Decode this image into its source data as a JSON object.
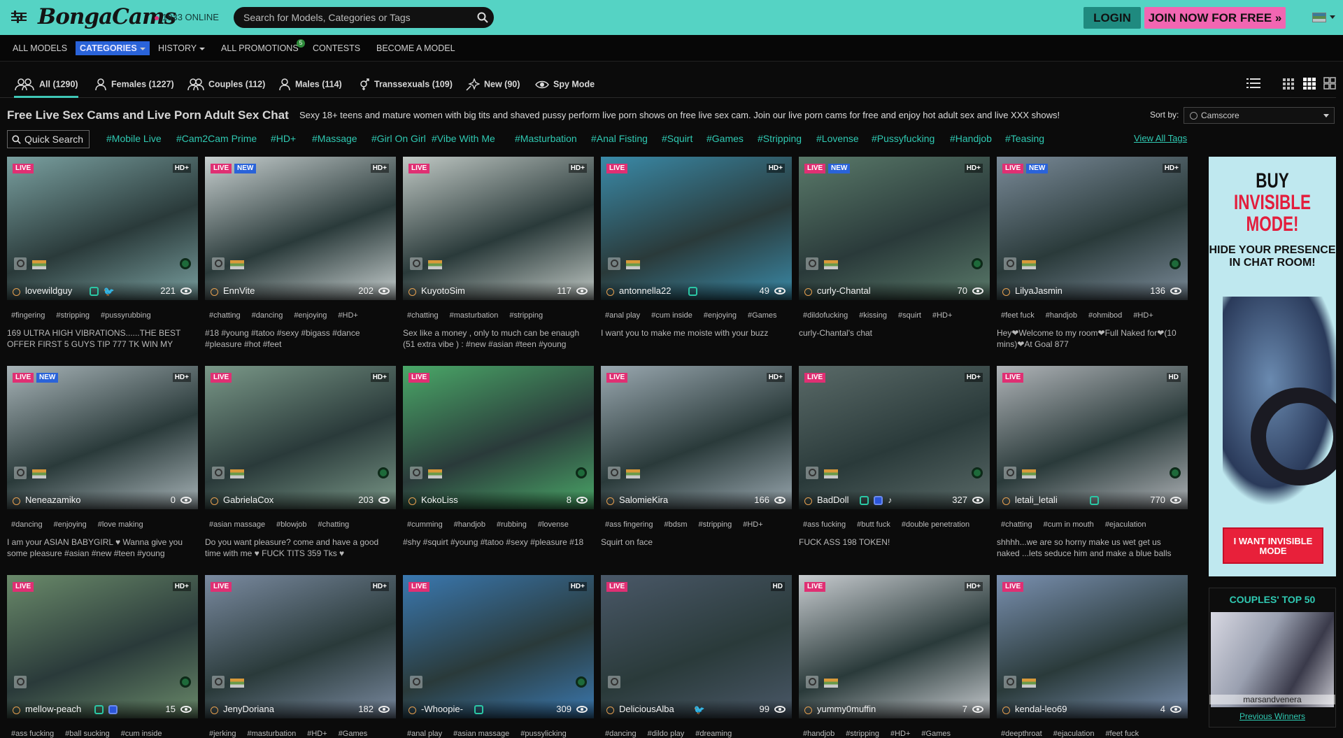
{
  "header": {
    "logo": "BongaCams",
    "online": "1933 ONLINE",
    "search_placeholder": "Search for Models, Categories or Tags",
    "login": "LOGIN",
    "join": "JOIN NOW FOR FREE »"
  },
  "nav": {
    "items": [
      "ALL MODELS",
      "CATEGORIES",
      "HISTORY",
      "ALL PROMOTIONS",
      "CONTESTS",
      "BECOME A MODEL"
    ],
    "promo_badge": "5"
  },
  "tabs": [
    {
      "label": "All (1290)",
      "icon": "couple-icon"
    },
    {
      "label": "Females (1227)",
      "icon": "female-icon"
    },
    {
      "label": "Couples (112)",
      "icon": "couples-icon"
    },
    {
      "label": "Males (114)",
      "icon": "male-icon"
    },
    {
      "label": "Transsexuals (109)",
      "icon": "trans-icon"
    },
    {
      "label": "New (90)",
      "icon": "sparkle-icon"
    },
    {
      "label": "Spy Mode",
      "icon": "eye-icon"
    }
  ],
  "page": {
    "title": "Free Live Sex Cams and Live Porn Adult Sex Chat",
    "subtitle": "Sexy 18+ teens and mature women with big tits and shaved pussy perform live porn shows on free live sex cam. Join our live porn cams for free and enjoy hot adult sex and live XXX shows!",
    "sort_label": "Sort by:",
    "sort_value": "Camscore",
    "quick_search": "Quick Search",
    "view_all_tags": "View All Tags"
  },
  "tag_bar": [
    "#Mobile Live",
    "#Cam2Cam Prime",
    "#HD+",
    "#Massage",
    "#Girl On Girl",
    "#Vibe With Me",
    "#Masturbation",
    "#Anal Fisting",
    "#Squirt",
    "#Games",
    "#Stripping",
    "#Lovense",
    "#Pussyfucking",
    "#Handjob",
    "#Teasing"
  ],
  "cards": [
    {
      "name": "lovewildguy",
      "viewers": "221",
      "live": "LIVE",
      "new": "",
      "hd": "HD+",
      "tags": [
        "#fingering",
        "#stripping",
        "#pussyrubbing"
      ],
      "desc": "169 ULTRA HIGH VIBRATIONS......THE BEST OFFER FIRST 5 GUYS TIP 777 TK WIN MY",
      "thumb": "#7aa0a0"
    },
    {
      "name": "EnnVite",
      "viewers": "202",
      "live": "LIVE",
      "new": "NEW",
      "hd": "HD+",
      "tags": [
        "#chatting",
        "#dancing",
        "#enjoying",
        "#HD+"
      ],
      "desc": "#18 #young #tatoo #sexy #bigass #dance #pleasure #hot #feet",
      "thumb": "#c8d0d0"
    },
    {
      "name": "KuyotoSim",
      "viewers": "117",
      "live": "LIVE",
      "new": "",
      "hd": "HD+",
      "tags": [
        "#chatting",
        "#masturbation",
        "#stripping"
      ],
      "desc": "Sex like a money , only to much can be enaugh (51 extra vibe ) : #new #asian #teen #young",
      "thumb": "#c0c8c4"
    },
    {
      "name": "antonnella22",
      "viewers": "49",
      "live": "LIVE",
      "new": "",
      "hd": "HD+",
      "tags": [
        "#anal play",
        "#cum inside",
        "#enjoying",
        "#Games"
      ],
      "desc": "I want you to make me moiste with your buzz",
      "thumb": "#3a8aa8"
    },
    {
      "name": "curly-Chantal",
      "viewers": "70",
      "live": "LIVE",
      "new": "NEW",
      "hd": "HD+",
      "tags": [
        "#dildofucking",
        "#kissing",
        "#squirt",
        "#HD+"
      ],
      "desc": "curly-Chantal's chat",
      "thumb": "#5a7a6a"
    },
    {
      "name": "LilyaJasmin",
      "viewers": "136",
      "live": "LIVE",
      "new": "NEW",
      "hd": "HD+",
      "tags": [
        "#feet fuck",
        "#handjob",
        "#ohmibod",
        "#HD+"
      ],
      "desc": "Hey❤Welcome to my room❤Full Naked for❤(10 mins)❤At Goal 877",
      "thumb": "#7a8a98"
    },
    {
      "name": "Neneazamiko",
      "viewers": "0",
      "live": "LIVE",
      "new": "NEW",
      "hd": "HD+",
      "tags": [
        "#dancing",
        "#enjoying",
        "#love making"
      ],
      "desc": "I am your ASIAN BABYGIRL ♥ Wanna give you some pleasure #asian #new #teen #young",
      "thumb": "#a8b4b8"
    },
    {
      "name": "GabrielaCox",
      "viewers": "203",
      "live": "LIVE",
      "new": "",
      "hd": "HD+",
      "tags": [
        "#asian massage",
        "#blowjob",
        "#chatting"
      ],
      "desc": "Do you want pleasure? come and have a good time with me ♥ FUCK TITS 359 Tks ♥",
      "thumb": "#7a9888"
    },
    {
      "name": "KokoLiss",
      "viewers": "8",
      "live": "LIVE",
      "new": "",
      "hd": "",
      "tags": [
        "#cumming",
        "#handjob",
        "#rubbing",
        "#lovense"
      ],
      "desc": "#shy #squirt #young #tatoo #sexy #pleasure #18",
      "thumb": "#4aa868"
    },
    {
      "name": "SalomieKira",
      "viewers": "166",
      "live": "LIVE",
      "new": "",
      "hd": "HD+",
      "tags": [
        "#ass fingering",
        "#bdsm",
        "#stripping",
        "#HD+"
      ],
      "desc": "Squirt on face",
      "thumb": "#9aa8b0"
    },
    {
      "name": "BadDoll",
      "viewers": "327",
      "live": "LIVE",
      "new": "",
      "hd": "HD+",
      "tags": [
        "#ass fucking",
        "#butt fuck",
        "#double penetration"
      ],
      "desc": "FUCK ASS 198 TOKEN!",
      "thumb": "#5a6a68"
    },
    {
      "name": "letali_letali",
      "viewers": "770",
      "live": "LIVE",
      "new": "",
      "hd": "HD",
      "tags": [
        "#chatting",
        "#cum in mouth",
        "#ejaculation"
      ],
      "desc": "shhhh...we are so horny make us wet get us naked ...lets seduce him and make a blue balls",
      "thumb": "#b0b4b8"
    },
    {
      "name": "mellow-peach",
      "viewers": "15",
      "live": "LIVE",
      "new": "",
      "hd": "HD+",
      "tags": [
        "#ass fucking",
        "#ball sucking",
        "#cum inside"
      ],
      "desc": "",
      "thumb": "#6a8a6a"
    },
    {
      "name": "JenyDoriana",
      "viewers": "182",
      "live": "LIVE",
      "new": "",
      "hd": "HD+",
      "tags": [
        "#jerking",
        "#masturbation",
        "#HD+",
        "#Games"
      ],
      "desc": "",
      "thumb": "#7a8aa0"
    },
    {
      "name": "-Whoopie-",
      "viewers": "309",
      "live": "LIVE",
      "new": "",
      "hd": "HD+",
      "tags": [
        "#anal play",
        "#asian massage",
        "#pussylicking"
      ],
      "desc": "",
      "thumb": "#3a78b0"
    },
    {
      "name": "DeliciousAlba",
      "viewers": "99",
      "live": "LIVE",
      "new": "",
      "hd": "HD",
      "tags": [
        "#dancing",
        "#dildo play",
        "#dreaming"
      ],
      "desc": "",
      "thumb": "#4a5868"
    },
    {
      "name": "yummy0muffin",
      "viewers": "7",
      "live": "LIVE",
      "new": "",
      "hd": "HD+",
      "tags": [
        "#handjob",
        "#stripping",
        "#HD+",
        "#Games"
      ],
      "desc": "",
      "thumb": "#c8ccd0"
    },
    {
      "name": "kendal-leo69",
      "viewers": "4",
      "live": "LIVE",
      "new": "",
      "hd": "",
      "tags": [
        "#deepthroat",
        "#ejaculation",
        "#feet fuck"
      ],
      "desc": "",
      "thumb": "#7a90b0"
    }
  ],
  "promo": {
    "line1": "BUY",
    "line2": "INVISIBLE MODE!",
    "line3": "HIDE YOUR PRESENCE IN CHAT ROOM!",
    "button": "I WANT INVISIBLE MODE"
  },
  "top50": {
    "title": "COUPLES' TOP 50",
    "name": "marsandvenera",
    "link": "Previous Winners"
  }
}
